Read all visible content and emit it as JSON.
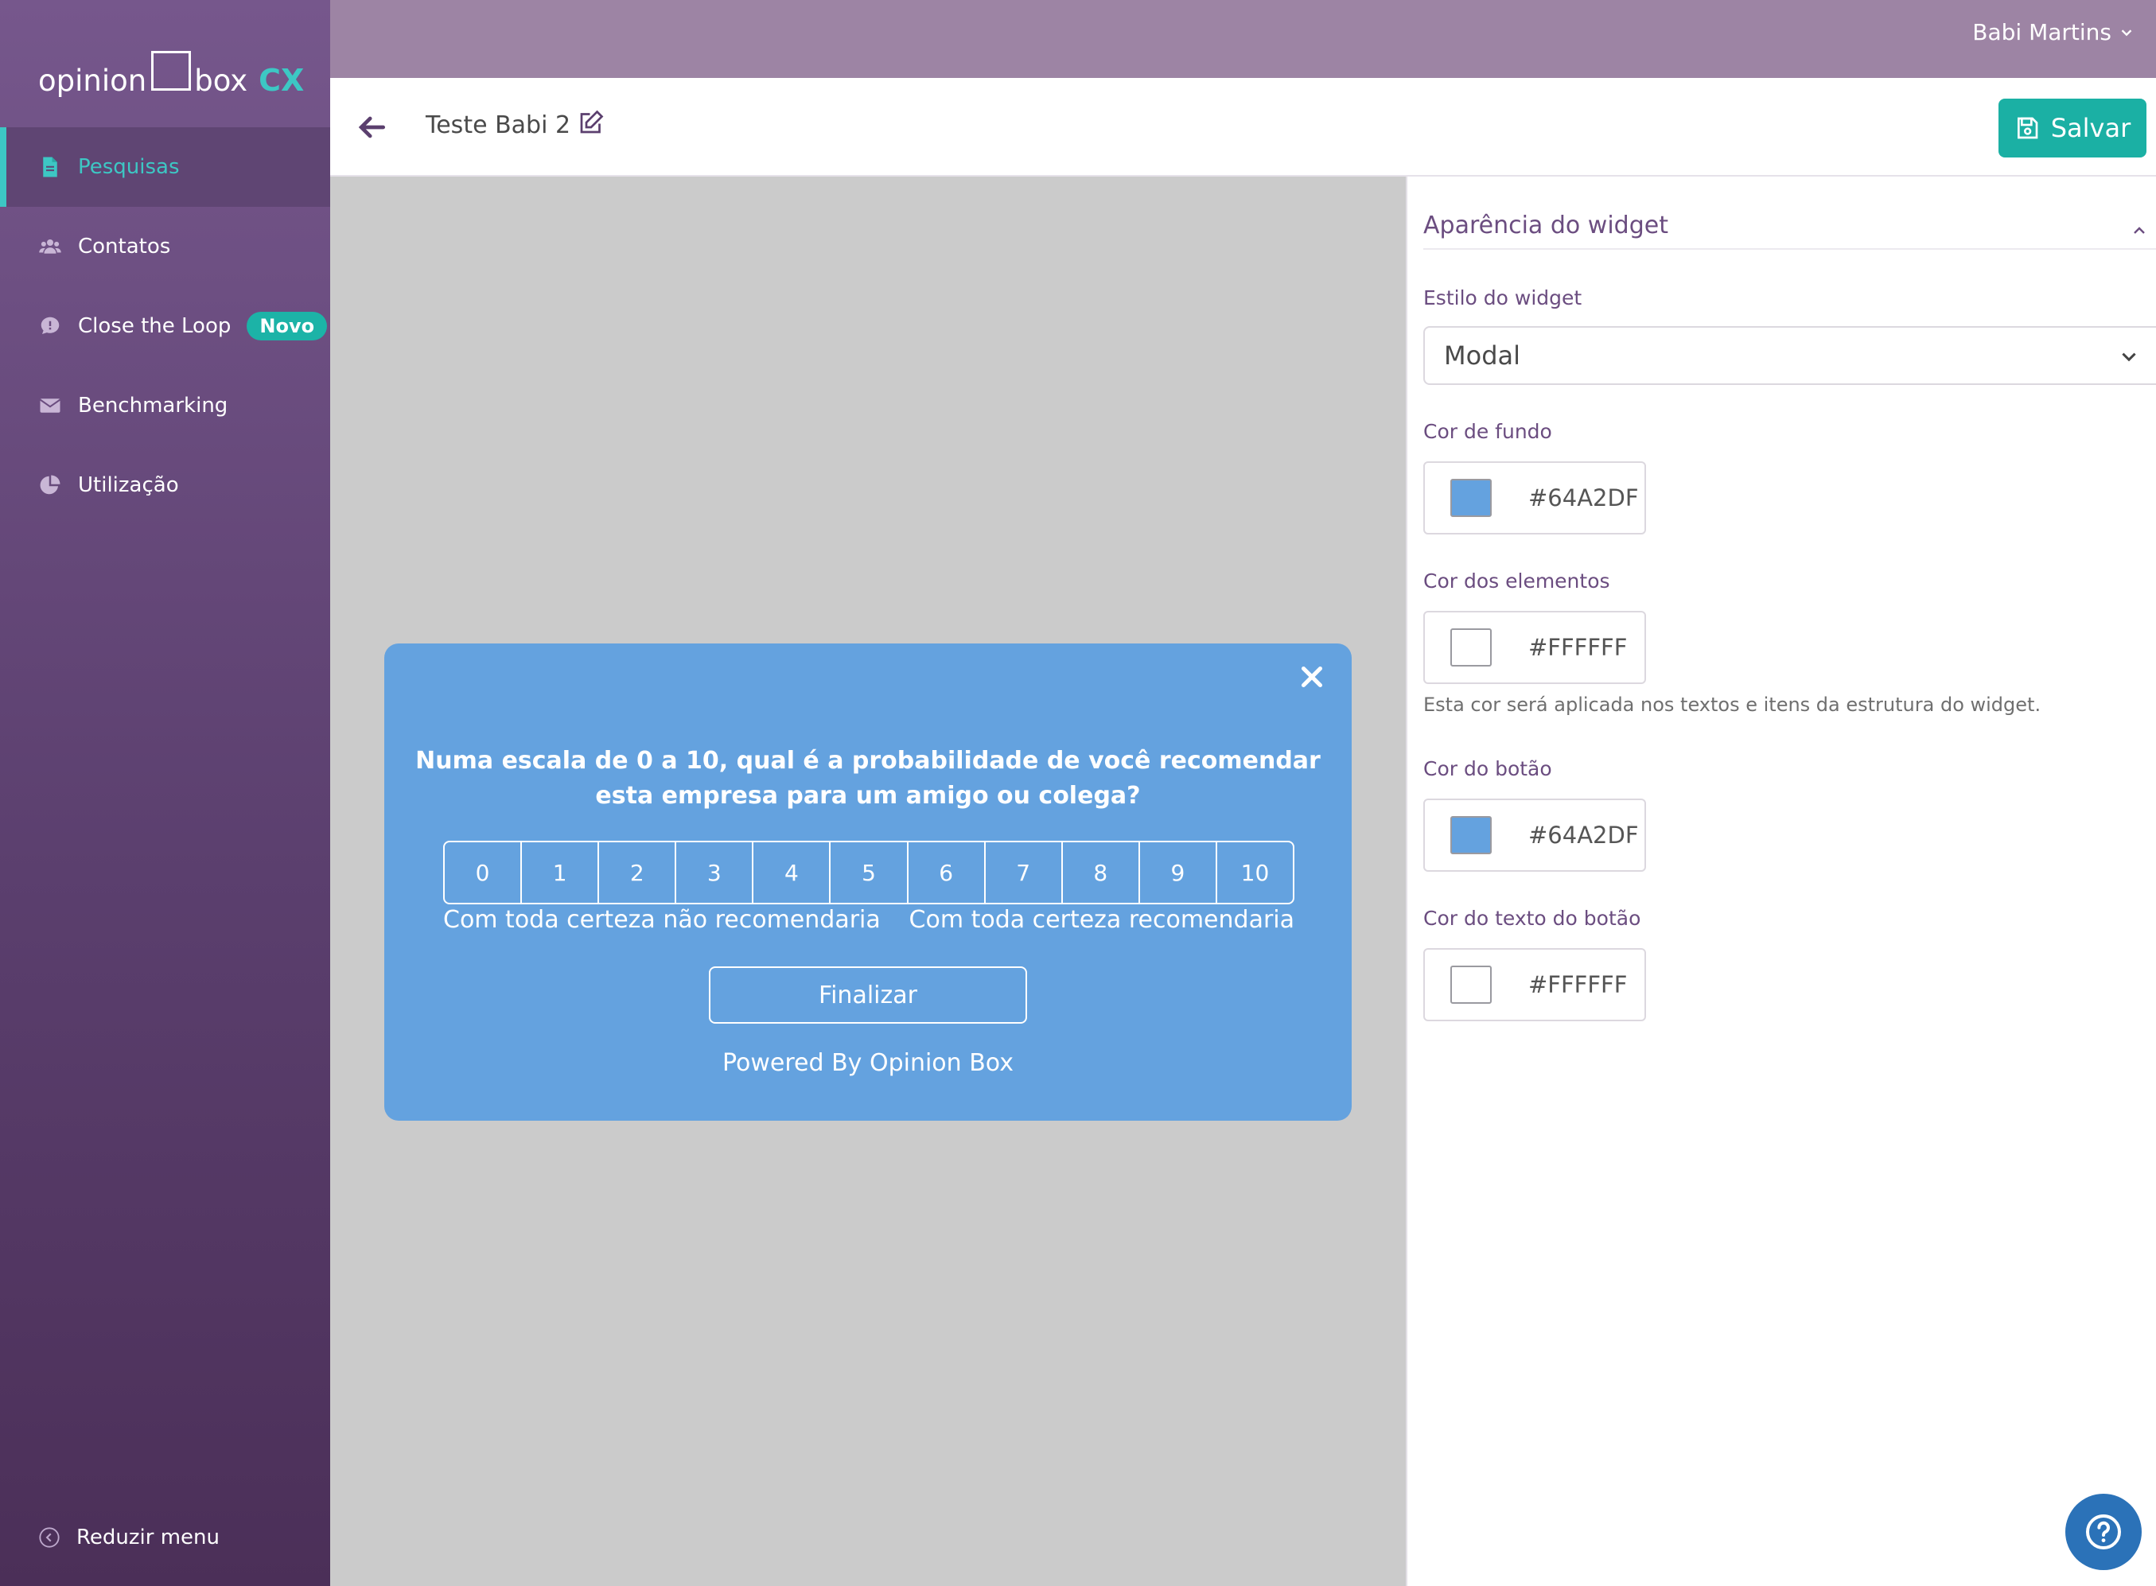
{
  "brand": {
    "word1": "opinion",
    "word2": "box",
    "cx": "CX"
  },
  "sidebar": {
    "items": [
      {
        "label": "Pesquisas",
        "icon": "document-icon"
      },
      {
        "label": "Contatos",
        "icon": "users-icon"
      },
      {
        "label": "Close the Loop",
        "icon": "chat-icon",
        "badge": "Novo"
      },
      {
        "label": "Benchmarking",
        "icon": "envelope-icon"
      },
      {
        "label": "Utilização",
        "icon": "pie-chart-icon"
      }
    ],
    "reduce_label": "Reduzir menu"
  },
  "topbar": {
    "user_name": "Babi Martins"
  },
  "header": {
    "survey_title": "Teste Babi 2",
    "save_label": "Salvar"
  },
  "widget": {
    "background": "#64A2DF",
    "question": "Numa escala de 0 a 10, qual é a probabilidade de você recomendar esta empresa para um amigo ou colega?",
    "scale": [
      "0",
      "1",
      "2",
      "3",
      "4",
      "5",
      "6",
      "7",
      "8",
      "9",
      "10"
    ],
    "low_label": "Com toda certeza não recomendaria",
    "high_label": "Com toda certeza recomendaria",
    "finish_label": "Finalizar",
    "powered_by": "Powered By Opinion Box"
  },
  "panel": {
    "section_title": "Aparência do widget",
    "style_label": "Estilo do widget",
    "style_value": "Modal",
    "bg_color_label": "Cor de fundo",
    "bg_color_value": "#64A2DF",
    "elements_color_label": "Cor dos elementos",
    "elements_color_value": "#FFFFFF",
    "elements_hint": "Esta cor será aplicada nos textos e itens da estrutura do widget.",
    "button_color_label": "Cor do botão",
    "button_color_value": "#64A2DF",
    "button_text_color_label": "Cor do texto do botão",
    "button_text_color_value": "#FFFFFF"
  },
  "colors": {
    "accent": "#1BB0A4",
    "sidebar": "#76578C",
    "topbar": "#9D84A4",
    "help": "#2B72B8"
  }
}
